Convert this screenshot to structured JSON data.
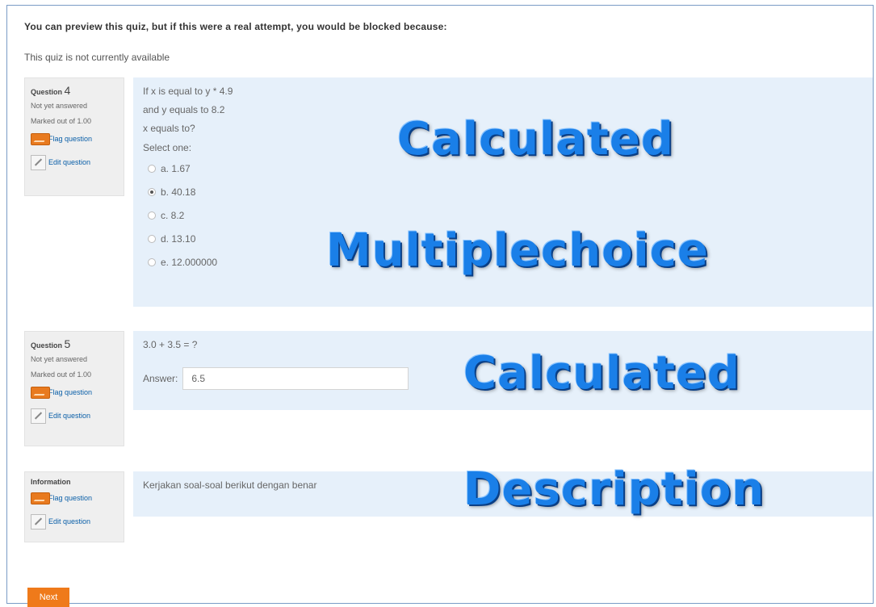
{
  "notice": "You can preview this quiz, but if this were a real attempt, you would be blocked because:",
  "unavailable": "This quiz is not currently available",
  "q4": {
    "label": "Question",
    "number": "4",
    "status": "Not yet answered",
    "marked": "Marked out of 1.00",
    "flag": "Flag question",
    "edit": "Edit question",
    "stem": [
      "If x is equal to y * 4.9",
      "and y equals to 8.2",
      "x equals to?"
    ],
    "select_one": "Select one:",
    "options": [
      "a. 1.67",
      "b. 40.18",
      "c. 8.2",
      "d. 13.10",
      "e. 12.000000"
    ],
    "selected_index": 1,
    "overlay_1": "Calculated",
    "overlay_2": "Multiplechoice"
  },
  "q5": {
    "label": "Question",
    "number": "5",
    "status": "Not yet answered",
    "marked": "Marked out of 1.00",
    "flag": "Flag question",
    "edit": "Edit question",
    "stem": "3.0 + 3.5 = ?",
    "answer_label": "Answer:",
    "answer_value": "6.5",
    "overlay": "Calculated"
  },
  "info": {
    "label": "Information",
    "flag": "Flag question",
    "edit": "Edit question",
    "text": "Kerjakan soal-soal berikut dengan benar",
    "overlay": "Description"
  },
  "next_label": "Next",
  "colors": {
    "accent": "#ef7a1a",
    "content_bg": "#e6f0fa",
    "overlay_text": "#1a7fe8"
  }
}
